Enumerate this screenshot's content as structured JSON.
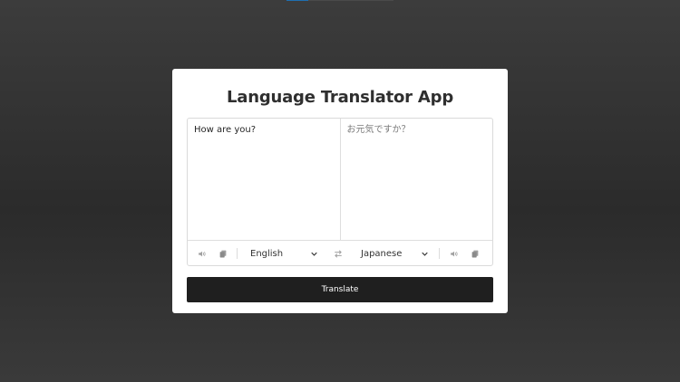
{
  "app": {
    "title": "Language Translator App"
  },
  "from": {
    "text": "How are you?",
    "language": "English",
    "speak_icon": "volume-icon",
    "copy_icon": "copy-icon"
  },
  "to": {
    "text": "お元気ですか？",
    "language": "Japanese",
    "speak_icon": "volume-icon",
    "copy_icon": "copy-icon"
  },
  "controls": {
    "exchange_icon": "exchange-icon"
  },
  "actions": {
    "translate_label": "Translate"
  },
  "colors": {
    "button_bg": "#1f1f1f",
    "card_bg": "#ffffff",
    "page_bg": "#2b2b2b",
    "accent": "#1f6fb0"
  }
}
